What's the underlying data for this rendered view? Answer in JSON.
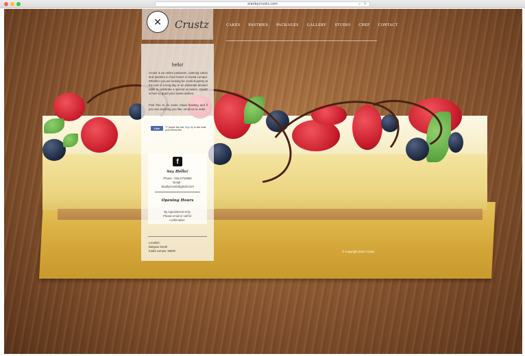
{
  "browser": {
    "url": "xiaobycrustz.com"
  },
  "site": {
    "logo_text": "Crustz"
  },
  "nav": {
    "items": [
      "CAKES",
      "PASTRIES",
      "PACKAGES",
      "GALLERY",
      "STUDIO",
      "CHEF",
      "CONTACT"
    ]
  },
  "sidebar": {
    "heading": "hello!",
    "intro": "Crustz is an online patisserie, catering cakes and pastries to food lovers in Kuala Lumpur. Whether you are looking for comfort pastry at the end of a long day or an elaborate dessert table to celebrate a special occasion, Crustz is here to grant your sweet wishes.",
    "intro2": "Feel free to do some visual feasting and if you see anything you like, email us to order.",
    "fb_like": {
      "button": "Like",
      "text_pre": "77 people like this.",
      "link": "Sign Up",
      "text_post": "to see what your friends like."
    },
    "say_hello": {
      "title": "Say Hello!",
      "phone": "Phone : 016-2710592",
      "email_label": "Email :",
      "email": "xiaobycrustz@gmail.com"
    },
    "hours": {
      "title": "Opening Hours",
      "line1": "By Appointment Only.",
      "line2": "Please email or call for",
      "line3": "confirmation."
    },
    "location": {
      "label": "Location:",
      "line1": "Bangsar South",
      "line2": "Kuala Lumpur, 59200"
    }
  },
  "footer": {
    "copyright": "© Copyright 2012 Crustz"
  },
  "colors": {
    "sidebar_bg": "#ffffff",
    "nav_text": "#ffffff",
    "facebook": "#4c68a8"
  }
}
